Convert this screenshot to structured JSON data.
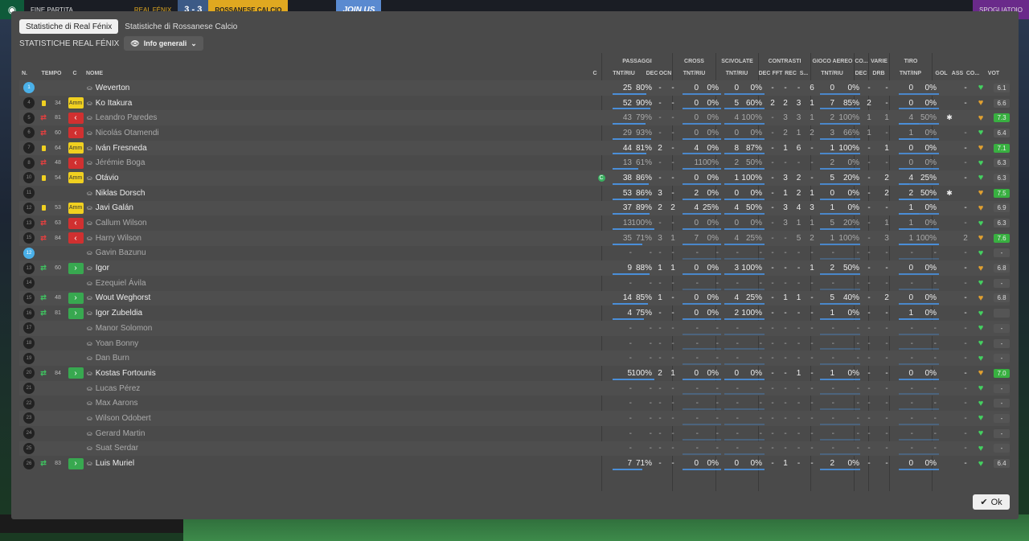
{
  "topbar": {
    "finish": "FINE PARTITA",
    "home": "REAL FÉNIX",
    "score": "3 - 3",
    "away": "ROSSANESE CALCIO",
    "join": "JOIN US",
    "right": "SPOGLIATOIO"
  },
  "tabs": [
    {
      "label": "Statistiche di Real Fénix"
    },
    {
      "label": "Statistiche di Rossanese Calcio"
    }
  ],
  "subtitle": "STATISTICHE REAL FÉNIX",
  "view_select": "Info generali",
  "ok_label": "Ok",
  "groups": {
    "passaggi": "PASSAGGI",
    "cross": "CROSS",
    "scivolate": "SCIVOLATE",
    "contrasti": "CONTRASTI",
    "gioco_aereo": "GIOCO AEREO",
    "co": "CO...",
    "varie": "VARIE",
    "tiro": "TIRO"
  },
  "headers": {
    "n": "N.",
    "tempo": "TEMPO",
    "c": "C",
    "nome": "NOME",
    "c2": "C",
    "pass_tnt": "TNT/RIU",
    "dec": "DEC",
    "ocn": "OCN",
    "cross_tnt": "TNT/RIU",
    "sciv_tnt": "TNT/RIU",
    "cont_dec": "DEC",
    "fft": "FFT",
    "rec": "REC",
    "s": "S...",
    "aer_tnt": "TNT/RIU",
    "co_dec": "DEC",
    "drb": "DRB",
    "tiro_tnt": "TNT/INP",
    "gol": "GOL",
    "ass": "ASS",
    "co": "CO...",
    "vot": "VOT"
  },
  "players": [
    {
      "n": "1",
      "gk": true,
      "tempo": "",
      "card": false,
      "sub": "",
      "tag": "",
      "name": "Weverton",
      "cap": false,
      "p1": "25",
      "p2": "80%",
      "pb": 0.8,
      "dec": "-",
      "ocn": "-",
      "cr1": "0",
      "cr2": "0%",
      "sc1": "0",
      "sc2": "0%",
      "cd": "-",
      "fft": "-",
      "rec": "-",
      "s": "6",
      "a1": "0",
      "a2": "0%",
      "cdec": "-",
      "drb": "-",
      "t1": "0",
      "t2": "0%",
      "gol": "",
      "ass": "-",
      "cog": false,
      "vote": "6.1",
      "hi": false,
      "off": false
    },
    {
      "n": "4",
      "gk": false,
      "tempo": "34",
      "card": true,
      "sub": "",
      "tag": "amm",
      "name": "Ko Itakura",
      "cap": false,
      "p1": "52",
      "p2": "90%",
      "pb": 0.9,
      "dec": "-",
      "ocn": "-",
      "cr1": "0",
      "cr2": "0%",
      "sc1": "5",
      "sc2": "60%",
      "cd": "2",
      "fft": "2",
      "rec": "3",
      "s": "1",
      "a1": "7",
      "a2": "85%",
      "cdec": "2",
      "drb": "-",
      "t1": "0",
      "t2": "0%",
      "gol": "",
      "ass": "-",
      "cog": false,
      "vote": "6.6",
      "hi": false,
      "off": false
    },
    {
      "n": "5",
      "gk": false,
      "tempo": "81",
      "card": false,
      "sub": "off",
      "tag": "out",
      "name": "Leandro Paredes",
      "cap": false,
      "p1": "43",
      "p2": "79%",
      "pb": 0.79,
      "dec": "-",
      "ocn": "-",
      "cr1": "0",
      "cr2": "0%",
      "sc1": "4",
      "sc2": "100%",
      "cd": "-",
      "fft": "3",
      "rec": "3",
      "s": "1",
      "a1": "2",
      "a2": "100%",
      "cdec": "1",
      "drb": "1",
      "t1": "4",
      "t2": "50%",
      "gol": "",
      "ass": "",
      "cog": true,
      "vote": "7.3",
      "hi": true,
      "off": true
    },
    {
      "n": "6",
      "gk": false,
      "tempo": "60",
      "card": false,
      "sub": "off",
      "tag": "out",
      "name": "Nicolás Otamendi",
      "cap": false,
      "p1": "29",
      "p2": "93%",
      "pb": 0.93,
      "dec": "-",
      "ocn": "-",
      "cr1": "0",
      "cr2": "0%",
      "sc1": "0",
      "sc2": "0%",
      "cd": "-",
      "fft": "2",
      "rec": "1",
      "s": "2",
      "a1": "3",
      "a2": "66%",
      "cdec": "1",
      "drb": "-",
      "t1": "1",
      "t2": "0%",
      "gol": "",
      "ass": "-",
      "cog": false,
      "vote": "6.4",
      "hi": false,
      "off": true
    },
    {
      "n": "7",
      "gk": false,
      "tempo": "64",
      "card": true,
      "sub": "",
      "tag": "amm",
      "name": "Iván Fresneda",
      "cap": false,
      "p1": "44",
      "p2": "81%",
      "pb": 0.81,
      "dec": "2",
      "ocn": "-",
      "cr1": "4",
      "cr2": "0%",
      "sc1": "8",
      "sc2": "87%",
      "cd": "-",
      "fft": "1",
      "rec": "6",
      "s": "-",
      "a1": "1",
      "a2": "100%",
      "cdec": "-",
      "drb": "1",
      "t1": "0",
      "t2": "0%",
      "gol": "",
      "ass": "-",
      "cog": false,
      "vote": "7.1",
      "hi": true,
      "off": false
    },
    {
      "n": "8",
      "gk": false,
      "tempo": "48",
      "card": false,
      "sub": "off",
      "tag": "out",
      "name": "Jérémie Boga",
      "cap": false,
      "p1": "13",
      "p2": "61%",
      "pb": 0.61,
      "dec": "-",
      "ocn": "-",
      "cr1": "1",
      "cr2": "100%",
      "sc1": "2",
      "sc2": "50%",
      "cd": "-",
      "fft": "-",
      "rec": "-",
      "s": "-",
      "a1": "2",
      "a2": "0%",
      "cdec": "-",
      "drb": "-",
      "t1": "0",
      "t2": "0%",
      "gol": "",
      "ass": "-",
      "cog": false,
      "vote": "6.3",
      "hi": false,
      "off": true
    },
    {
      "n": "10",
      "gk": false,
      "tempo": "54",
      "card": true,
      "sub": "",
      "tag": "amm",
      "name": "Otávio",
      "cap": true,
      "p1": "38",
      "p2": "86%",
      "pb": 0.86,
      "dec": "-",
      "ocn": "-",
      "cr1": "0",
      "cr2": "0%",
      "sc1": "1",
      "sc2": "100%",
      "cd": "-",
      "fft": "3",
      "rec": "2",
      "s": "-",
      "a1": "5",
      "a2": "20%",
      "cdec": "-",
      "drb": "2",
      "t1": "4",
      "t2": "25%",
      "gol": "",
      "ass": "-",
      "cog": false,
      "vote": "6.3",
      "hi": false,
      "off": false
    },
    {
      "n": "11",
      "gk": false,
      "tempo": "",
      "card": false,
      "sub": "",
      "tag": "",
      "name": "Niklas Dorsch",
      "cap": false,
      "p1": "53",
      "p2": "86%",
      "pb": 0.86,
      "dec": "3",
      "ocn": "-",
      "cr1": "2",
      "cr2": "0%",
      "sc1": "0",
      "sc2": "0%",
      "cd": "-",
      "fft": "1",
      "rec": "2",
      "s": "1",
      "a1": "0",
      "a2": "0%",
      "cdec": "-",
      "drb": "2",
      "t1": "2",
      "t2": "50%",
      "gol": "",
      "ass": "",
      "cog": true,
      "vote": "7.5",
      "hi": true,
      "off": false
    },
    {
      "n": "12",
      "gk": false,
      "tempo": "53",
      "card": true,
      "sub": "",
      "tag": "amm",
      "name": "Javi Galán",
      "cap": false,
      "p1": "37",
      "p2": "89%",
      "pb": 0.89,
      "dec": "2",
      "ocn": "2",
      "cr1": "4",
      "cr2": "25%",
      "sc1": "4",
      "sc2": "50%",
      "cd": "-",
      "fft": "3",
      "rec": "4",
      "s": "3",
      "a1": "1",
      "a2": "0%",
      "cdec": "-",
      "drb": "-",
      "t1": "1",
      "t2": "0%",
      "gol": "",
      "ass": "-",
      "cog": false,
      "vote": "6.9",
      "hi": false,
      "off": false
    },
    {
      "n": "13",
      "gk": false,
      "tempo": "63",
      "card": false,
      "sub": "off",
      "tag": "out",
      "name": "Callum Wilson",
      "cap": false,
      "p1": "13",
      "p2": "100%",
      "pb": 1,
      "dec": "-",
      "ocn": "-",
      "cr1": "0",
      "cr2": "0%",
      "sc1": "0",
      "sc2": "0%",
      "cd": "-",
      "fft": "3",
      "rec": "1",
      "s": "1",
      "a1": "5",
      "a2": "20%",
      "cdec": "-",
      "drb": "1",
      "t1": "1",
      "t2": "0%",
      "gol": "",
      "ass": "-",
      "cog": false,
      "vote": "6.3",
      "hi": false,
      "off": true
    },
    {
      "n": "15",
      "gk": false,
      "tempo": "84",
      "card": false,
      "sub": "off",
      "tag": "out",
      "name": "Harry Wilson",
      "cap": false,
      "p1": "35",
      "p2": "71%",
      "pb": 0.71,
      "dec": "3",
      "ocn": "1",
      "cr1": "7",
      "cr2": "0%",
      "sc1": "4",
      "sc2": "25%",
      "cd": "-",
      "fft": "-",
      "rec": "5",
      "s": "2",
      "a1": "1",
      "a2": "100%",
      "cdec": "-",
      "drb": "3",
      "t1": "1",
      "t2": "100%",
      "gol": "",
      "ass": "2",
      "cog": false,
      "vote": "7.6",
      "hi": true,
      "off": true
    },
    {
      "n": "12",
      "gk": true,
      "tempo": "",
      "card": false,
      "sub": "",
      "tag": "",
      "name": "Gavin Bazunu",
      "cap": false,
      "p1": "-",
      "p2": "-",
      "pb": 0,
      "dec": "-",
      "ocn": "-",
      "cr1": "-",
      "cr2": "-",
      "sc1": "-",
      "sc2": "-",
      "cd": "-",
      "fft": "-",
      "rec": "-",
      "s": "-",
      "a1": "-",
      "a2": "-",
      "cdec": "-",
      "drb": "-",
      "t1": "-",
      "t2": "-",
      "gol": "",
      "ass": "-",
      "cog": false,
      "vote": "-",
      "hi": false,
      "off": true
    },
    {
      "n": "13",
      "gk": false,
      "tempo": "60",
      "card": false,
      "sub": "on",
      "tag": "in",
      "name": "Igor",
      "cap": false,
      "p1": "9",
      "p2": "88%",
      "pb": 0.88,
      "dec": "1",
      "ocn": "1",
      "cr1": "0",
      "cr2": "0%",
      "sc1": "3",
      "sc2": "100%",
      "cd": "-",
      "fft": "-",
      "rec": "-",
      "s": "1",
      "a1": "2",
      "a2": "50%",
      "cdec": "-",
      "drb": "-",
      "t1": "0",
      "t2": "0%",
      "gol": "",
      "ass": "-",
      "cog": false,
      "vote": "6.8",
      "hi": false,
      "off": false
    },
    {
      "n": "14",
      "gk": false,
      "tempo": "",
      "card": false,
      "sub": "",
      "tag": "",
      "name": "Ezequiel Ávila",
      "cap": false,
      "p1": "-",
      "p2": "-",
      "pb": 0,
      "dec": "-",
      "ocn": "-",
      "cr1": "-",
      "cr2": "-",
      "sc1": "-",
      "sc2": "-",
      "cd": "-",
      "fft": "-",
      "rec": "-",
      "s": "-",
      "a1": "-",
      "a2": "-",
      "cdec": "-",
      "drb": "-",
      "t1": "-",
      "t2": "-",
      "gol": "",
      "ass": "-",
      "cog": false,
      "vote": "-",
      "hi": false,
      "off": true
    },
    {
      "n": "15",
      "gk": false,
      "tempo": "48",
      "card": false,
      "sub": "on",
      "tag": "in",
      "name": "Wout Weghorst",
      "cap": false,
      "p1": "14",
      "p2": "85%",
      "pb": 0.85,
      "dec": "1",
      "ocn": "-",
      "cr1": "0",
      "cr2": "0%",
      "sc1": "4",
      "sc2": "25%",
      "cd": "-",
      "fft": "1",
      "rec": "1",
      "s": "-",
      "a1": "5",
      "a2": "40%",
      "cdec": "-",
      "drb": "2",
      "t1": "0",
      "t2": "0%",
      "gol": "",
      "ass": "-",
      "cog": false,
      "vote": "6.8",
      "hi": false,
      "off": false
    },
    {
      "n": "16",
      "gk": false,
      "tempo": "81",
      "card": false,
      "sub": "on",
      "tag": "in",
      "name": "Igor Zubeldia",
      "cap": false,
      "p1": "4",
      "p2": "75%",
      "pb": 0.75,
      "dec": "-",
      "ocn": "-",
      "cr1": "0",
      "cr2": "0%",
      "sc1": "2",
      "sc2": "100%",
      "cd": "-",
      "fft": "-",
      "rec": "-",
      "s": "-",
      "a1": "1",
      "a2": "0%",
      "cdec": "-",
      "drb": "-",
      "t1": "1",
      "t2": "0%",
      "gol": "",
      "ass": "-",
      "cog": false,
      "vote": "",
      "hi": false,
      "off": false
    },
    {
      "n": "17",
      "gk": false,
      "tempo": "",
      "card": false,
      "sub": "",
      "tag": "",
      "name": "Manor Solomon",
      "cap": false,
      "p1": "-",
      "p2": "-",
      "pb": 0,
      "dec": "-",
      "ocn": "-",
      "cr1": "-",
      "cr2": "-",
      "sc1": "-",
      "sc2": "-",
      "cd": "-",
      "fft": "-",
      "rec": "-",
      "s": "-",
      "a1": "-",
      "a2": "-",
      "cdec": "-",
      "drb": "-",
      "t1": "-",
      "t2": "-",
      "gol": "",
      "ass": "-",
      "cog": false,
      "vote": "-",
      "hi": false,
      "off": true
    },
    {
      "n": "18",
      "gk": false,
      "tempo": "",
      "card": false,
      "sub": "",
      "tag": "",
      "name": "Yoan Bonny",
      "cap": false,
      "p1": "-",
      "p2": "-",
      "pb": 0,
      "dec": "-",
      "ocn": "-",
      "cr1": "-",
      "cr2": "-",
      "sc1": "-",
      "sc2": "-",
      "cd": "-",
      "fft": "-",
      "rec": "-",
      "s": "-",
      "a1": "-",
      "a2": "-",
      "cdec": "-",
      "drb": "-",
      "t1": "-",
      "t2": "-",
      "gol": "",
      "ass": "-",
      "cog": false,
      "vote": "-",
      "hi": false,
      "off": true
    },
    {
      "n": "19",
      "gk": false,
      "tempo": "",
      "card": false,
      "sub": "",
      "tag": "",
      "name": "Dan Burn",
      "cap": false,
      "p1": "-",
      "p2": "-",
      "pb": 0,
      "dec": "-",
      "ocn": "-",
      "cr1": "-",
      "cr2": "-",
      "sc1": "-",
      "sc2": "-",
      "cd": "-",
      "fft": "-",
      "rec": "-",
      "s": "-",
      "a1": "-",
      "a2": "-",
      "cdec": "-",
      "drb": "-",
      "t1": "-",
      "t2": "-",
      "gol": "",
      "ass": "-",
      "cog": false,
      "vote": "-",
      "hi": false,
      "off": true
    },
    {
      "n": "20",
      "gk": false,
      "tempo": "84",
      "card": false,
      "sub": "on",
      "tag": "in",
      "name": "Kostas Fortounis",
      "cap": false,
      "p1": "5",
      "p2": "100%",
      "pb": 1,
      "dec": "2",
      "ocn": "1",
      "cr1": "0",
      "cr2": "0%",
      "sc1": "0",
      "sc2": "0%",
      "cd": "-",
      "fft": "-",
      "rec": "1",
      "s": "-",
      "a1": "1",
      "a2": "0%",
      "cdec": "-",
      "drb": "-",
      "t1": "0",
      "t2": "0%",
      "gol": "",
      "ass": "-",
      "cog": false,
      "vote": "7.0",
      "hi": true,
      "off": false
    },
    {
      "n": "21",
      "gk": false,
      "tempo": "",
      "card": false,
      "sub": "",
      "tag": "",
      "name": "Lucas Pérez",
      "cap": false,
      "p1": "-",
      "p2": "-",
      "pb": 0,
      "dec": "-",
      "ocn": "-",
      "cr1": "-",
      "cr2": "-",
      "sc1": "-",
      "sc2": "-",
      "cd": "-",
      "fft": "-",
      "rec": "-",
      "s": "-",
      "a1": "-",
      "a2": "-",
      "cdec": "-",
      "drb": "-",
      "t1": "-",
      "t2": "-",
      "gol": "",
      "ass": "-",
      "cog": false,
      "vote": "-",
      "hi": false,
      "off": true
    },
    {
      "n": "22",
      "gk": false,
      "tempo": "",
      "card": false,
      "sub": "",
      "tag": "",
      "name": "Max Aarons",
      "cap": false,
      "p1": "-",
      "p2": "-",
      "pb": 0,
      "dec": "-",
      "ocn": "-",
      "cr1": "-",
      "cr2": "-",
      "sc1": "-",
      "sc2": "-",
      "cd": "-",
      "fft": "-",
      "rec": "-",
      "s": "-",
      "a1": "-",
      "a2": "-",
      "cdec": "-",
      "drb": "-",
      "t1": "-",
      "t2": "-",
      "gol": "",
      "ass": "-",
      "cog": false,
      "vote": "-",
      "hi": false,
      "off": true
    },
    {
      "n": "23",
      "gk": false,
      "tempo": "",
      "card": false,
      "sub": "",
      "tag": "",
      "name": "Wilson Odobert",
      "cap": false,
      "p1": "-",
      "p2": "-",
      "pb": 0,
      "dec": "-",
      "ocn": "-",
      "cr1": "-",
      "cr2": "-",
      "sc1": "-",
      "sc2": "-",
      "cd": "-",
      "fft": "-",
      "rec": "-",
      "s": "-",
      "a1": "-",
      "a2": "-",
      "cdec": "-",
      "drb": "-",
      "t1": "-",
      "t2": "-",
      "gol": "",
      "ass": "-",
      "cog": false,
      "vote": "-",
      "hi": false,
      "off": true
    },
    {
      "n": "24",
      "gk": false,
      "tempo": "",
      "card": false,
      "sub": "",
      "tag": "",
      "name": "Gerard Martin",
      "cap": false,
      "p1": "-",
      "p2": "-",
      "pb": 0,
      "dec": "-",
      "ocn": "-",
      "cr1": "-",
      "cr2": "-",
      "sc1": "-",
      "sc2": "-",
      "cd": "-",
      "fft": "-",
      "rec": "-",
      "s": "-",
      "a1": "-",
      "a2": "-",
      "cdec": "-",
      "drb": "-",
      "t1": "-",
      "t2": "-",
      "gol": "",
      "ass": "-",
      "cog": false,
      "vote": "-",
      "hi": false,
      "off": true
    },
    {
      "n": "25",
      "gk": false,
      "tempo": "",
      "card": false,
      "sub": "",
      "tag": "",
      "name": "Suat Serdar",
      "cap": false,
      "p1": "-",
      "p2": "-",
      "pb": 0,
      "dec": "-",
      "ocn": "-",
      "cr1": "-",
      "cr2": "-",
      "sc1": "-",
      "sc2": "-",
      "cd": "-",
      "fft": "-",
      "rec": "-",
      "s": "-",
      "a1": "-",
      "a2": "-",
      "cdec": "-",
      "drb": "-",
      "t1": "-",
      "t2": "-",
      "gol": "",
      "ass": "-",
      "cog": false,
      "vote": "-",
      "hi": false,
      "off": true
    },
    {
      "n": "26",
      "gk": false,
      "tempo": "83",
      "card": false,
      "sub": "on",
      "tag": "in",
      "name": "Luis Muriel",
      "cap": false,
      "p1": "7",
      "p2": "71%",
      "pb": 0.71,
      "dec": "-",
      "ocn": "-",
      "cr1": "0",
      "cr2": "0%",
      "sc1": "0",
      "sc2": "0%",
      "cd": "-",
      "fft": "1",
      "rec": "-",
      "s": "-",
      "a1": "2",
      "a2": "0%",
      "cdec": "-",
      "drb": "-",
      "t1": "0",
      "t2": "0%",
      "gol": "",
      "ass": "-",
      "cog": false,
      "vote": "6.4",
      "hi": false,
      "off": false
    }
  ]
}
